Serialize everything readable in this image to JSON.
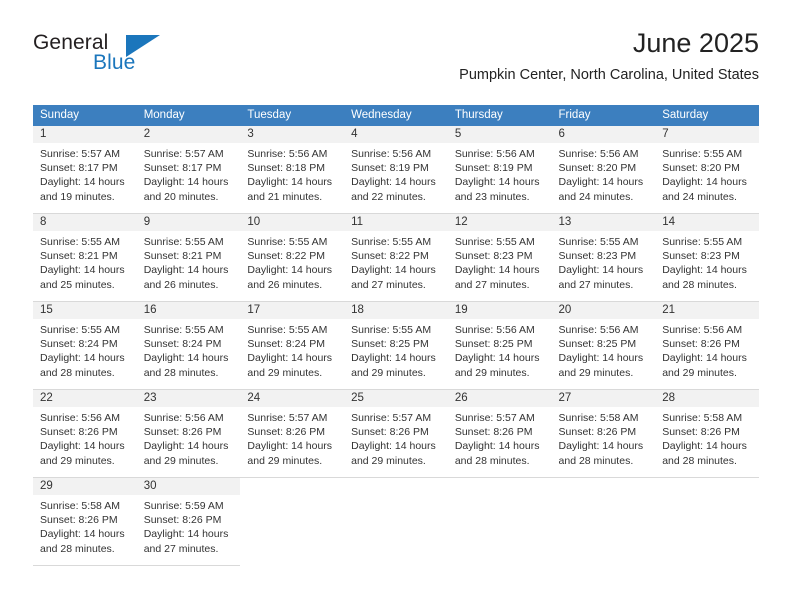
{
  "brand": {
    "name_top": "General",
    "name_bottom": "Blue",
    "triangle_color": "#1b76bc",
    "top_color": "#231f20"
  },
  "header": {
    "title": "June 2025",
    "subtitle": "Pumpkin Center, North Carolina, United States"
  },
  "theme": {
    "header_row_bg": "#3c7fbf",
    "header_row_text": "#ffffff",
    "daynum_band_bg": "#f2f2f2",
    "cell_border": "#d9d9d9",
    "body_text": "#333333"
  },
  "calendar": {
    "weekday_headers": [
      "Sunday",
      "Monday",
      "Tuesday",
      "Wednesday",
      "Thursday",
      "Friday",
      "Saturday"
    ],
    "weeks": [
      [
        {
          "day": "1",
          "sunrise": "Sunrise: 5:57 AM",
          "sunset": "Sunset: 8:17 PM",
          "daylight": "Daylight: 14 hours and 19 minutes."
        },
        {
          "day": "2",
          "sunrise": "Sunrise: 5:57 AM",
          "sunset": "Sunset: 8:17 PM",
          "daylight": "Daylight: 14 hours and 20 minutes."
        },
        {
          "day": "3",
          "sunrise": "Sunrise: 5:56 AM",
          "sunset": "Sunset: 8:18 PM",
          "daylight": "Daylight: 14 hours and 21 minutes."
        },
        {
          "day": "4",
          "sunrise": "Sunrise: 5:56 AM",
          "sunset": "Sunset: 8:19 PM",
          "daylight": "Daylight: 14 hours and 22 minutes."
        },
        {
          "day": "5",
          "sunrise": "Sunrise: 5:56 AM",
          "sunset": "Sunset: 8:19 PM",
          "daylight": "Daylight: 14 hours and 23 minutes."
        },
        {
          "day": "6",
          "sunrise": "Sunrise: 5:56 AM",
          "sunset": "Sunset: 8:20 PM",
          "daylight": "Daylight: 14 hours and 24 minutes."
        },
        {
          "day": "7",
          "sunrise": "Sunrise: 5:55 AM",
          "sunset": "Sunset: 8:20 PM",
          "daylight": "Daylight: 14 hours and 24 minutes."
        }
      ],
      [
        {
          "day": "8",
          "sunrise": "Sunrise: 5:55 AM",
          "sunset": "Sunset: 8:21 PM",
          "daylight": "Daylight: 14 hours and 25 minutes."
        },
        {
          "day": "9",
          "sunrise": "Sunrise: 5:55 AM",
          "sunset": "Sunset: 8:21 PM",
          "daylight": "Daylight: 14 hours and 26 minutes."
        },
        {
          "day": "10",
          "sunrise": "Sunrise: 5:55 AM",
          "sunset": "Sunset: 8:22 PM",
          "daylight": "Daylight: 14 hours and 26 minutes."
        },
        {
          "day": "11",
          "sunrise": "Sunrise: 5:55 AM",
          "sunset": "Sunset: 8:22 PM",
          "daylight": "Daylight: 14 hours and 27 minutes."
        },
        {
          "day": "12",
          "sunrise": "Sunrise: 5:55 AM",
          "sunset": "Sunset: 8:23 PM",
          "daylight": "Daylight: 14 hours and 27 minutes."
        },
        {
          "day": "13",
          "sunrise": "Sunrise: 5:55 AM",
          "sunset": "Sunset: 8:23 PM",
          "daylight": "Daylight: 14 hours and 27 minutes."
        },
        {
          "day": "14",
          "sunrise": "Sunrise: 5:55 AM",
          "sunset": "Sunset: 8:23 PM",
          "daylight": "Daylight: 14 hours and 28 minutes."
        }
      ],
      [
        {
          "day": "15",
          "sunrise": "Sunrise: 5:55 AM",
          "sunset": "Sunset: 8:24 PM",
          "daylight": "Daylight: 14 hours and 28 minutes."
        },
        {
          "day": "16",
          "sunrise": "Sunrise: 5:55 AM",
          "sunset": "Sunset: 8:24 PM",
          "daylight": "Daylight: 14 hours and 28 minutes."
        },
        {
          "day": "17",
          "sunrise": "Sunrise: 5:55 AM",
          "sunset": "Sunset: 8:24 PM",
          "daylight": "Daylight: 14 hours and 29 minutes."
        },
        {
          "day": "18",
          "sunrise": "Sunrise: 5:55 AM",
          "sunset": "Sunset: 8:25 PM",
          "daylight": "Daylight: 14 hours and 29 minutes."
        },
        {
          "day": "19",
          "sunrise": "Sunrise: 5:56 AM",
          "sunset": "Sunset: 8:25 PM",
          "daylight": "Daylight: 14 hours and 29 minutes."
        },
        {
          "day": "20",
          "sunrise": "Sunrise: 5:56 AM",
          "sunset": "Sunset: 8:25 PM",
          "daylight": "Daylight: 14 hours and 29 minutes."
        },
        {
          "day": "21",
          "sunrise": "Sunrise: 5:56 AM",
          "sunset": "Sunset: 8:26 PM",
          "daylight": "Daylight: 14 hours and 29 minutes."
        }
      ],
      [
        {
          "day": "22",
          "sunrise": "Sunrise: 5:56 AM",
          "sunset": "Sunset: 8:26 PM",
          "daylight": "Daylight: 14 hours and 29 minutes."
        },
        {
          "day": "23",
          "sunrise": "Sunrise: 5:56 AM",
          "sunset": "Sunset: 8:26 PM",
          "daylight": "Daylight: 14 hours and 29 minutes."
        },
        {
          "day": "24",
          "sunrise": "Sunrise: 5:57 AM",
          "sunset": "Sunset: 8:26 PM",
          "daylight": "Daylight: 14 hours and 29 minutes."
        },
        {
          "day": "25",
          "sunrise": "Sunrise: 5:57 AM",
          "sunset": "Sunset: 8:26 PM",
          "daylight": "Daylight: 14 hours and 29 minutes."
        },
        {
          "day": "26",
          "sunrise": "Sunrise: 5:57 AM",
          "sunset": "Sunset: 8:26 PM",
          "daylight": "Daylight: 14 hours and 28 minutes."
        },
        {
          "day": "27",
          "sunrise": "Sunrise: 5:58 AM",
          "sunset": "Sunset: 8:26 PM",
          "daylight": "Daylight: 14 hours and 28 minutes."
        },
        {
          "day": "28",
          "sunrise": "Sunrise: 5:58 AM",
          "sunset": "Sunset: 8:26 PM",
          "daylight": "Daylight: 14 hours and 28 minutes."
        }
      ],
      [
        {
          "day": "29",
          "sunrise": "Sunrise: 5:58 AM",
          "sunset": "Sunset: 8:26 PM",
          "daylight": "Daylight: 14 hours and 28 minutes."
        },
        {
          "day": "30",
          "sunrise": "Sunrise: 5:59 AM",
          "sunset": "Sunset: 8:26 PM",
          "daylight": "Daylight: 14 hours and 27 minutes."
        },
        null,
        null,
        null,
        null,
        null
      ]
    ]
  }
}
